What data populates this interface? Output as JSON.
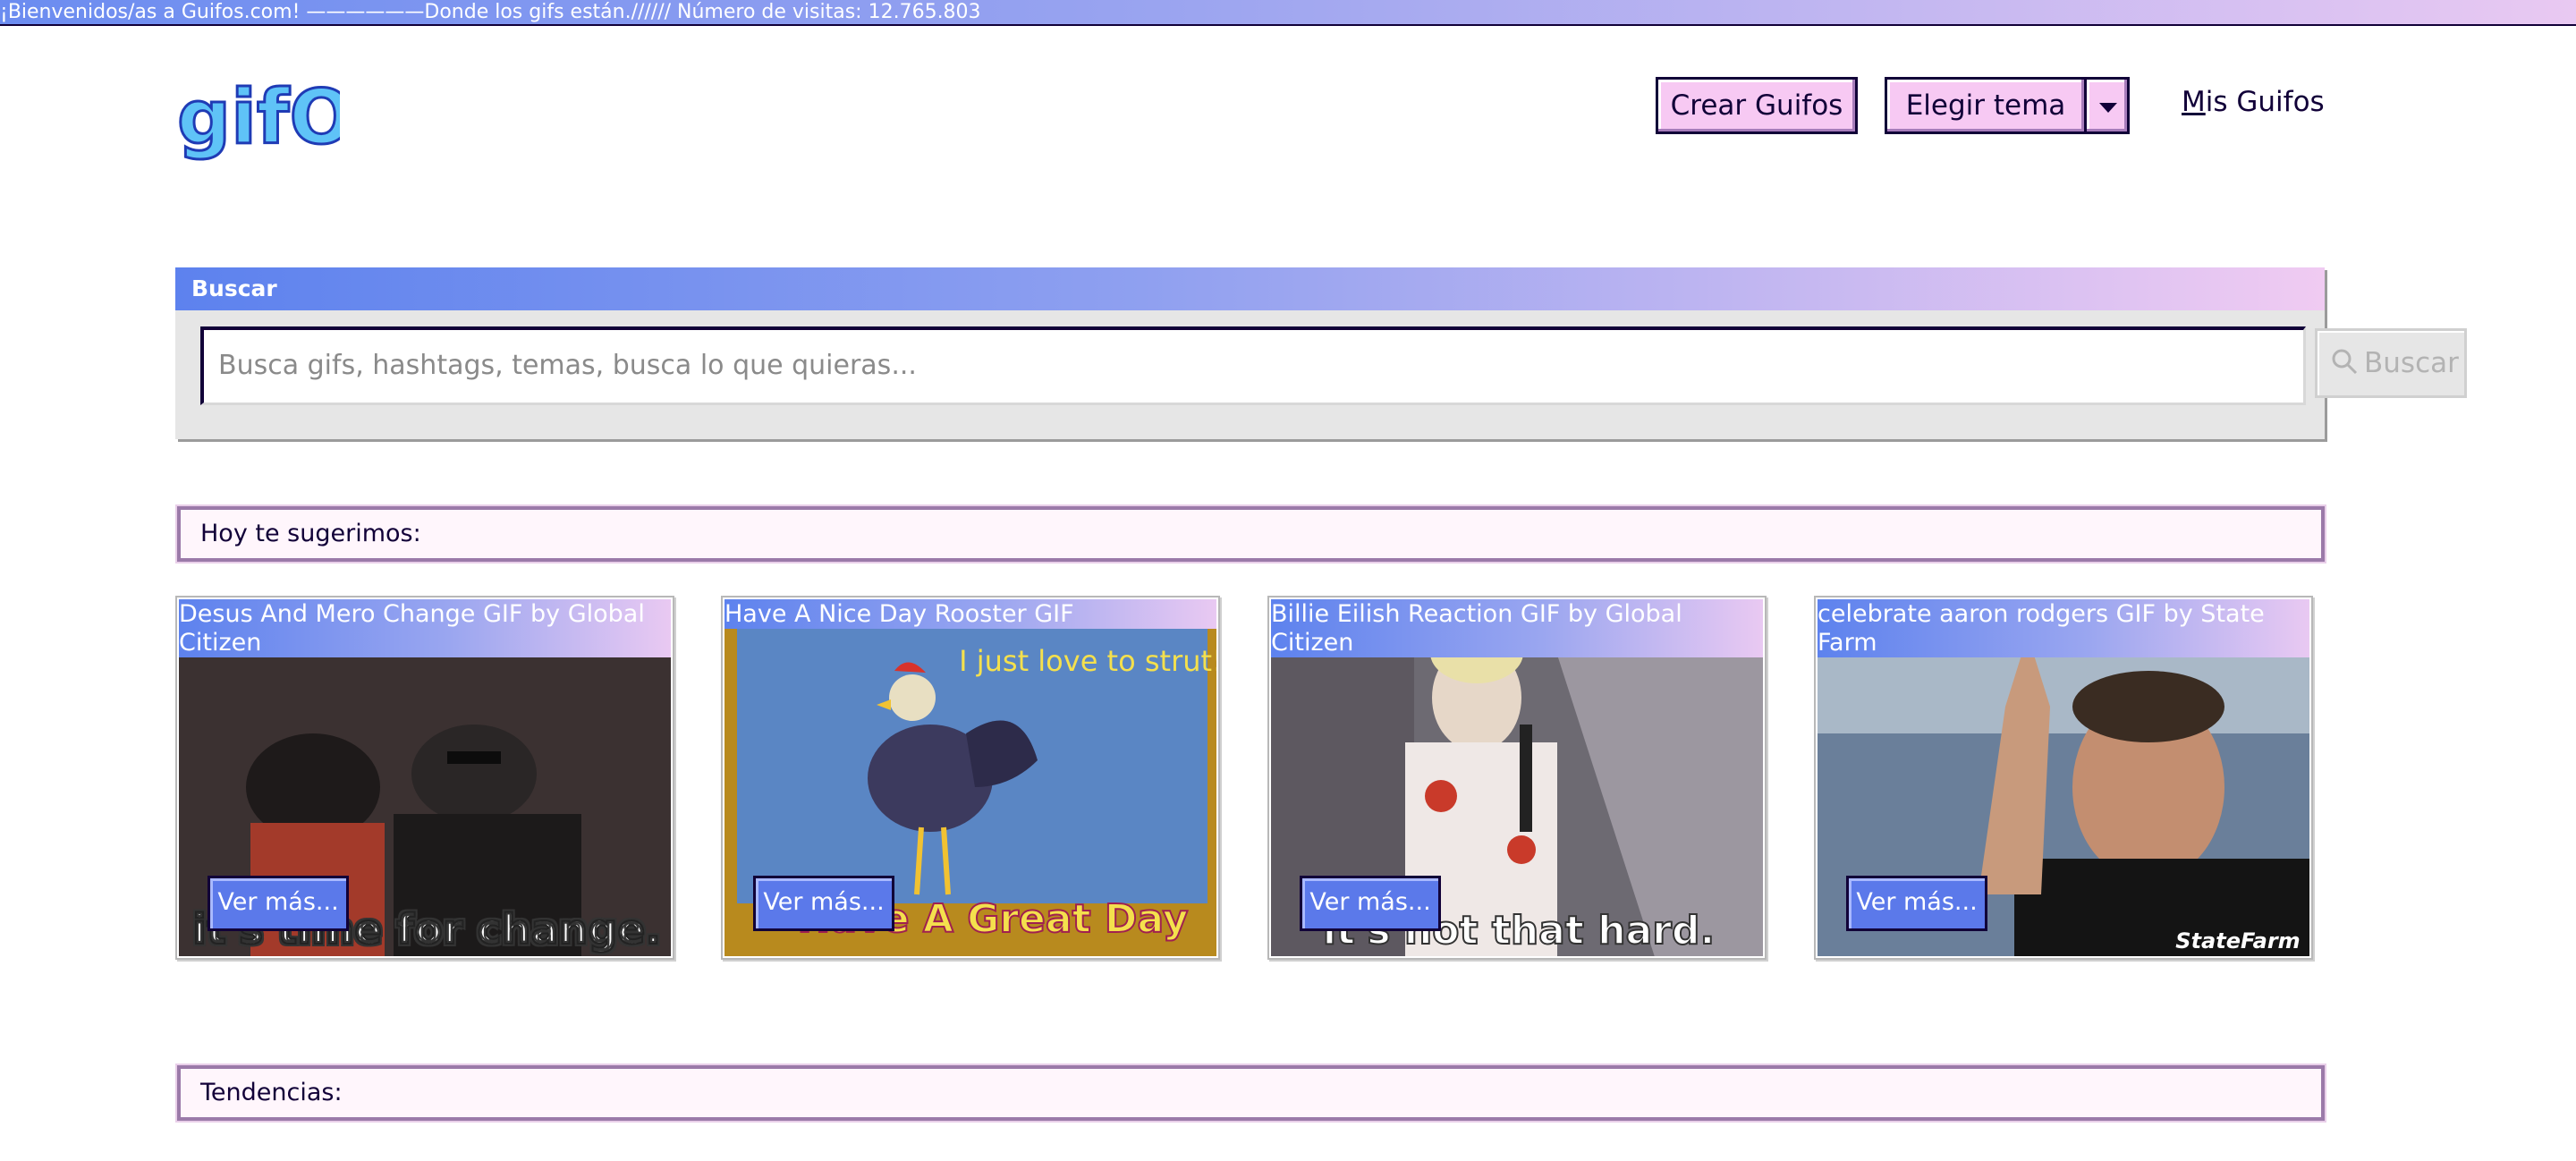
{
  "marquee": "¡Bienvenidos/as a Guifos.com! ——————Donde los gifs están.////// Número de visitas: 12.765.803",
  "header": {
    "logo_alt": "gifOS",
    "create_label": "Crear Guifos",
    "theme_label": "Elegir tema",
    "mis_prefix": "M",
    "mis_rest": "is Guifos"
  },
  "search": {
    "heading": "Buscar",
    "placeholder": "Busca gifs, hashtags, temas, busca lo que quieras...",
    "button_label": "Buscar"
  },
  "suggest": {
    "heading": "Hoy te sugerimos:",
    "cards": [
      {
        "title": "Desus And Mero Change GIF by Global Citizen",
        "caption": "it's time for change.",
        "button": "Ver más..."
      },
      {
        "title": "Have A Nice Day Rooster GIF",
        "caption": "Have A Great Day",
        "overlay": "I just love to strut!",
        "button": "Ver más..."
      },
      {
        "title": "Billie Eilish Reaction GIF by Global Citizen",
        "caption": "it's not that hard.",
        "button": "Ver más..."
      },
      {
        "title": "celebrate aaron rodgers GIF by State Farm",
        "caption": "StateFarm",
        "button": "Ver más..."
      }
    ]
  },
  "trends": {
    "heading": "Tendencias:"
  },
  "colors": {
    "accent": "#f7c9f3",
    "dark": "#110038",
    "blue": "#5b79ea"
  }
}
